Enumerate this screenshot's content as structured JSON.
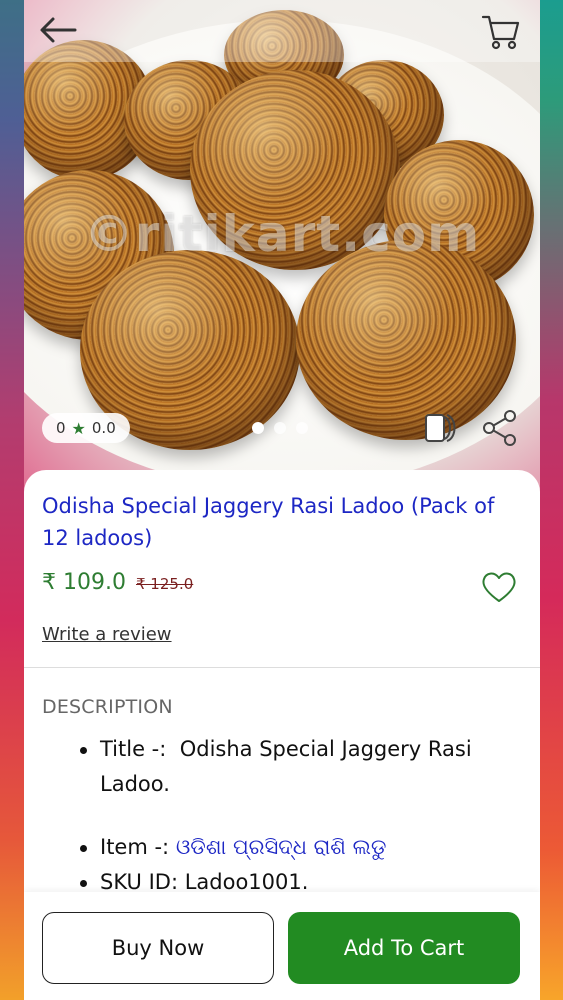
{
  "header": {
    "back_icon": "arrow-left-icon",
    "cart_icon": "shopping-cart-icon"
  },
  "hero": {
    "watermark": "©ritikart.com",
    "rating_count": "0",
    "rating_value": "0.0",
    "rating_icon": "star-icon",
    "carousel_dots": 3,
    "carousel_active_index": 0,
    "compare_icon": "compare-icon",
    "share_icon": "share-icon"
  },
  "product": {
    "title": "Odisha Special Jaggery Rasi Ladoo (Pack of 12 ladoos)",
    "price": "₹ 109.0",
    "mrp": "₹ 125.0",
    "wishlist_icon": "heart-icon",
    "review_link": "Write a review"
  },
  "description": {
    "heading": "DESCRIPTION",
    "title_label": "Title -:",
    "title_value": "Odisha Special Jaggery Rasi Ladoo.",
    "item_label": "Item -:",
    "item_value": "ଓଡିଶା ପ୍ରସିଦ୍ଧ ରାଶି ଲଡୁ",
    "sku": "SKU ID: Ladoo1001."
  },
  "actions": {
    "buy_now": "Buy Now",
    "add_to_cart": "Add To Cart"
  },
  "colors": {
    "title_blue": "#1d27c4",
    "price_green": "#2e7d32",
    "add_to_cart_green": "#228b22",
    "mrp_red": "#7a1f1f"
  }
}
